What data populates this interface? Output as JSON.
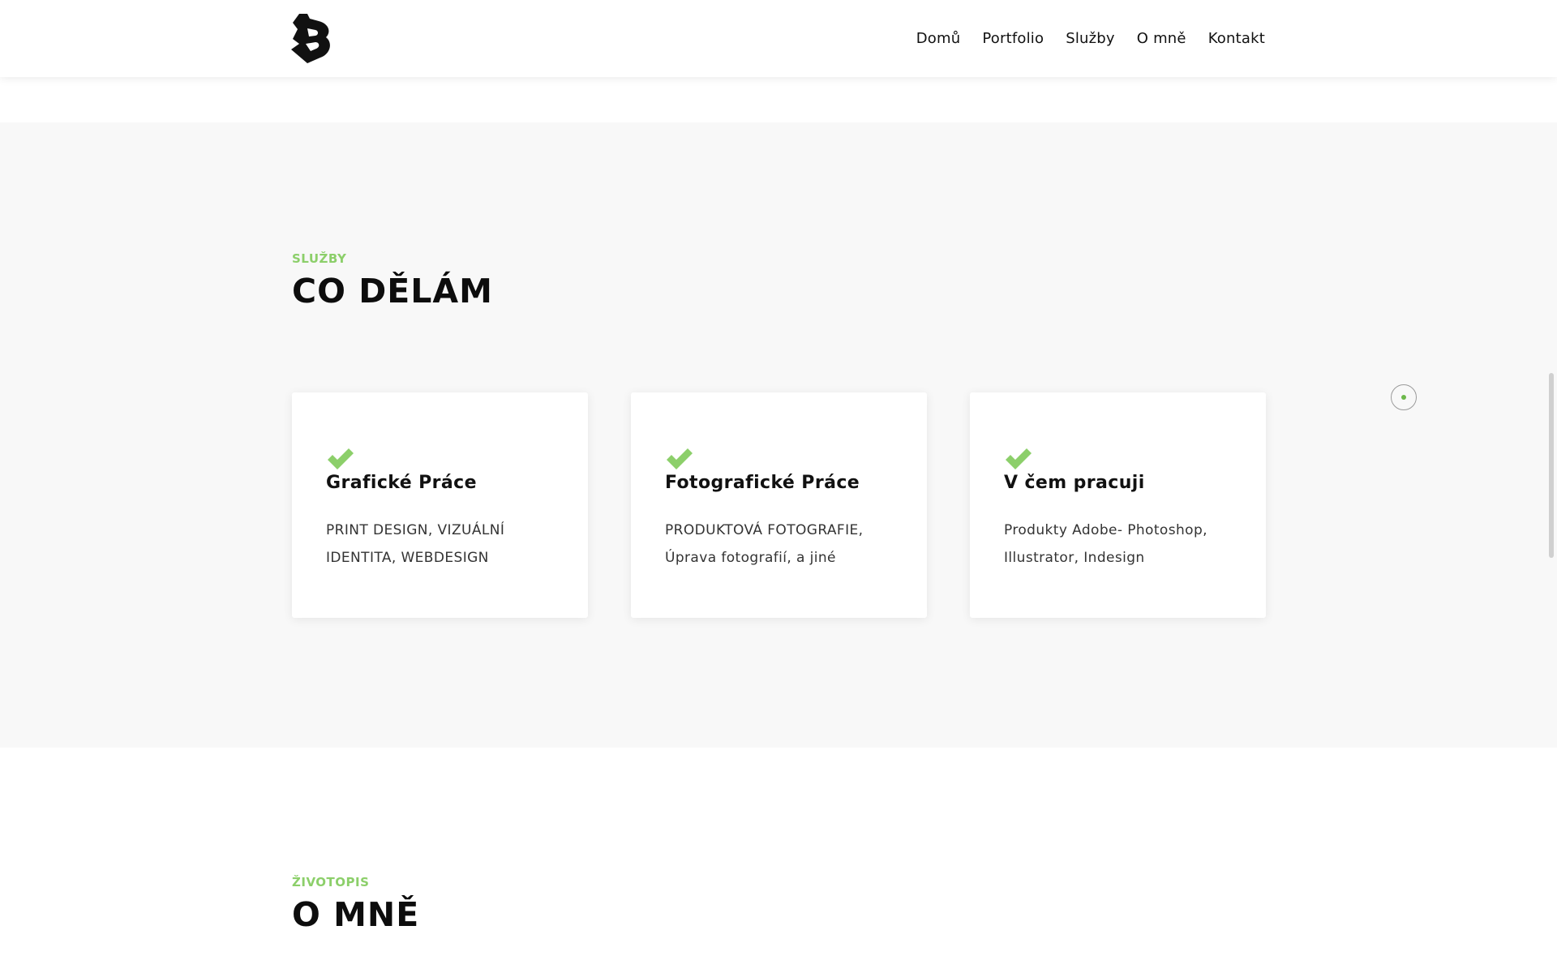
{
  "header": {
    "logo_icon": "logo-b-icon",
    "nav": [
      {
        "label": "Domů"
      },
      {
        "label": "Portfolio"
      },
      {
        "label": "Služby"
      },
      {
        "label": "O mně"
      },
      {
        "label": "Kontakt"
      }
    ]
  },
  "services": {
    "eyebrow": "SLUŽBY",
    "title": "CO DĚLÁM",
    "cards": [
      {
        "icon": "checkmark-icon",
        "title": "Grafické Práce",
        "text": "PRINT DESIGN, VIZUÁLNÍ IDENTITA, WEBDESIGN"
      },
      {
        "icon": "checkmark-icon",
        "title": "Fotografické Práce",
        "text": "PRODUKTOVÁ FOTOGRAFIE, Úprava fotografií, a jiné"
      },
      {
        "icon": "checkmark-icon",
        "title": "V čem pracuji",
        "text": "Produkty Adobe- Photoshop, Illustrator, Indesign"
      }
    ]
  },
  "about": {
    "eyebrow": "ŽIVOTOPIS",
    "title": "O MNĚ"
  },
  "colors": {
    "accent": "#8ccf6a",
    "section_bg": "#f8f8f8",
    "text": "#111111"
  }
}
